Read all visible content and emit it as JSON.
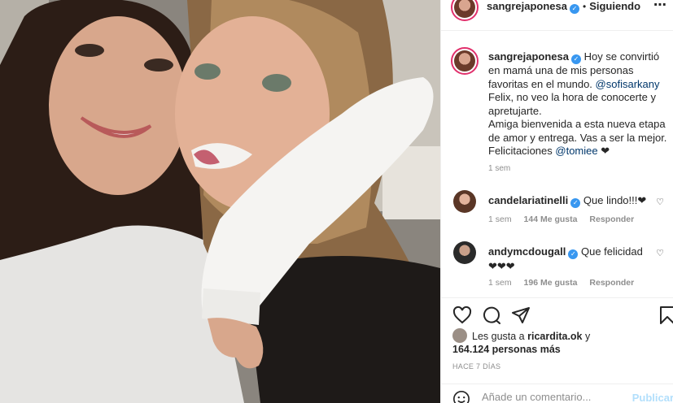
{
  "post": {
    "username": "sangrejaponesa",
    "follow_status": "Siguiendo",
    "more_icon": "⋯",
    "caption_lines": {
      "l1": "Hoy se convirtió",
      "l2": "en mamá una de mis personas",
      "l3": "favoritas en el mundo.",
      "mention1": "@sofisarkany",
      "l4": "Felix, no veo la hora de conocerte y",
      "l5": "apretujarte.",
      "l6": "Amiga bienvenida a esta nueva etapa",
      "l7": "de amor y entrega. Vas a ser la mejor.",
      "l8": "Felicitaciones",
      "mention2": "@tomiee",
      "heart": "❤"
    },
    "caption_time": "1 sem"
  },
  "comments": [
    {
      "username": "candelariatinelli",
      "text": "Que lindo!!!❤",
      "time": "1 sem",
      "likes": "144 Me gusta",
      "reply": "Responder"
    },
    {
      "username": "andymcdougall",
      "text": "Que felicidad",
      "text2": "❤❤❤",
      "time": "1 sem",
      "likes": "196 Me gusta",
      "reply": "Responder"
    }
  ],
  "likes": {
    "prefix": "Les gusta a",
    "user": "ricardita.ok",
    "joiner": "y",
    "count": "164.124 personas más"
  },
  "time_ago": "HACE 7 DÍAS",
  "comment_box": {
    "placeholder": "Añade un comentario...",
    "post_label": "Publicar"
  },
  "icons": {
    "like": "heart-icon",
    "comment": "comment-icon",
    "share": "share-icon",
    "save": "bookmark-icon",
    "emoji": "smiley-icon",
    "verified": "verified-badge-icon"
  },
  "colors": {
    "verified": "#3897f0",
    "link": "#00376b",
    "muted": "#8e8e8e",
    "post_disabled": "#b2dffc"
  }
}
